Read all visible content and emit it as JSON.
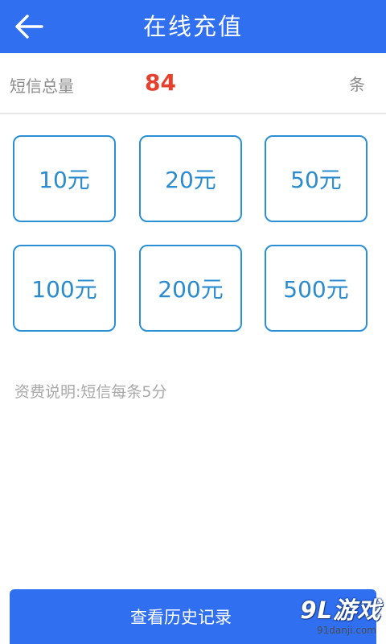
{
  "header": {
    "title": "在线充值",
    "back_icon": "arrow-left-icon"
  },
  "sms": {
    "label": "短信总量",
    "count": "84",
    "unit": "条"
  },
  "amounts": [
    {
      "label": "10元"
    },
    {
      "label": "20元"
    },
    {
      "label": "50元"
    },
    {
      "label": "100元"
    },
    {
      "label": "200元"
    },
    {
      "label": "500元"
    }
  ],
  "fee_note": "资费说明:短信每条5分",
  "history_button": "查看历史记录",
  "watermark": {
    "main": "9L游戏",
    "sub": "91danji.com"
  },
  "colors": {
    "header": "#2f6ff0",
    "count": "#e5412e",
    "amount_border": "#2b8fd6"
  }
}
